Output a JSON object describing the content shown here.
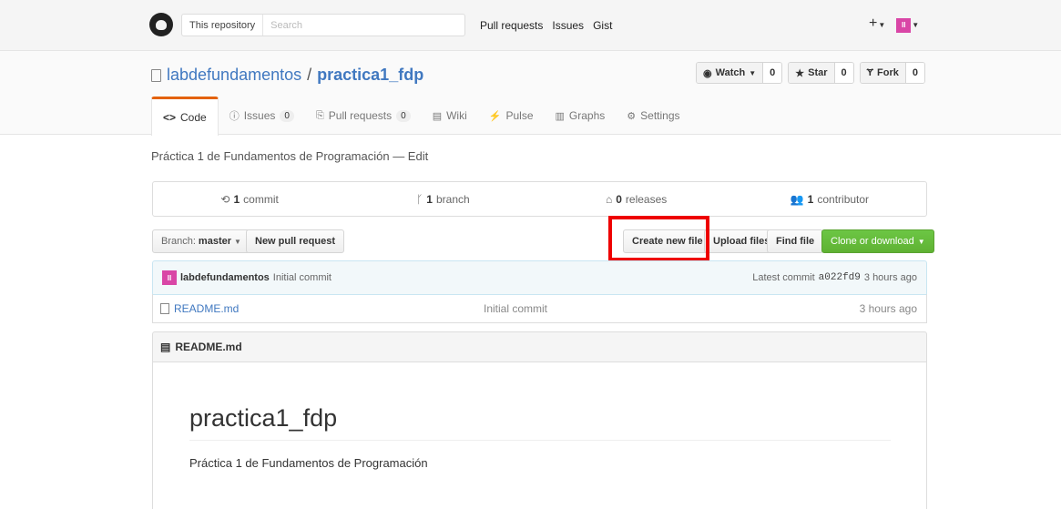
{
  "header": {
    "search_scope": "This repository",
    "search_placeholder": "Search",
    "nav": [
      "Pull requests",
      "Issues",
      "Gist"
    ],
    "plus_icon": "+",
    "avatar_initials": "II"
  },
  "repo": {
    "owner": "labdefundamentos",
    "separator": "/",
    "name": "practica1_fdp",
    "watch_label": "Watch",
    "watch_count": "0",
    "star_label": "Star",
    "star_count": "0",
    "fork_label": "Fork",
    "fork_count": "0"
  },
  "tabs": [
    {
      "icon": "<>",
      "label": "Code"
    },
    {
      "icon": "ⓘ",
      "label": "Issues",
      "count": "0"
    },
    {
      "icon": "⎘",
      "label": "Pull requests",
      "count": "0"
    },
    {
      "icon": "▤",
      "label": "Wiki"
    },
    {
      "icon": "⚡",
      "label": "Pulse"
    },
    {
      "icon": "▥",
      "label": "Graphs"
    },
    {
      "icon": "⚙",
      "label": "Settings"
    }
  ],
  "description": "Práctica 1 de Fundamentos de Programación — Edit",
  "summary": {
    "commits_num": "1",
    "commits_label": "commit",
    "branches_num": "1",
    "branches_label": "branch",
    "releases_num": "0",
    "releases_label": "releases",
    "contributors_num": "1",
    "contributors_label": "contributor"
  },
  "file_nav": {
    "branch_label": "Branch:",
    "branch_name": "master",
    "new_pr": "New pull request",
    "create_file": "Create new file",
    "upload_files": "Upload files",
    "find_file": "Find file",
    "clone": "Clone or download"
  },
  "latest_commit": {
    "author": "labdefundamentos",
    "message": "Initial commit",
    "latest_label": "Latest commit",
    "sha": "a022fd9",
    "age": "3 hours ago"
  },
  "files": [
    {
      "name": "README.md",
      "message": "Initial commit",
      "age": "3 hours ago"
    }
  ],
  "readme": {
    "filename": "README.md",
    "heading": "practica1_fdp",
    "body": "Práctica 1 de Fundamentos de Programación"
  },
  "colors": {
    "accent": "#4078c0",
    "highlight": "#ee0000",
    "clone_green": "#6cc644"
  }
}
